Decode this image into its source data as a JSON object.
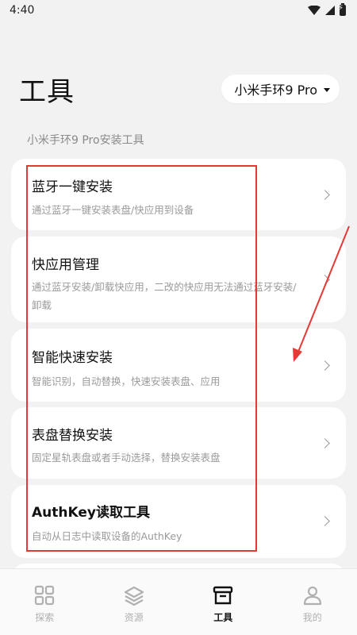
{
  "status_bar": {
    "time": "4:40"
  },
  "header": {
    "title": "工具",
    "device_selector": "小米手环9 Pro"
  },
  "section_label": "小米手环9 Pro安装工具",
  "tools": [
    {
      "title": "蓝牙一键安装",
      "description": "通过蓝牙一键安装表盘/快应用到设备"
    },
    {
      "title": "快应用管理",
      "description": "通过蓝牙安装/卸载快应用，二改的快应用无法通过蓝牙安装/卸载"
    },
    {
      "title": "智能快速安装",
      "description": "智能识别，自动替换，快速安装表盘、应用"
    },
    {
      "title": "表盘替换安装",
      "description": "固定星轨表盘或者手动选择，替换安装表盘"
    },
    {
      "title": "AuthKey读取工具",
      "description": "自动从日志中读取设备的AuthKey"
    }
  ],
  "bottom_nav": [
    {
      "label": "探索",
      "icon": "grid-icon",
      "active": false
    },
    {
      "label": "资源",
      "icon": "layers-icon",
      "active": false
    },
    {
      "label": "工具",
      "icon": "toolbox-icon",
      "active": true
    },
    {
      "label": "我的",
      "icon": "person-icon",
      "active": false
    }
  ],
  "colors": {
    "background": "#f2f2f2",
    "card": "#ffffff",
    "annotation": "#e53935",
    "inactive_nav": "#b0b0b0"
  }
}
